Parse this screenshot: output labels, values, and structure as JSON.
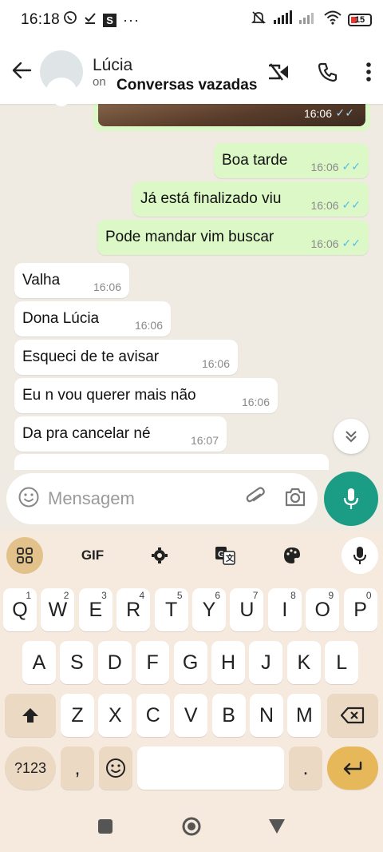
{
  "status_bar": {
    "time": "16:18",
    "battery": "15",
    "left_icons": [
      "whatsapp-icon",
      "check-download-icon",
      "s-app-icon",
      "more-dots-icon"
    ],
    "right_icons": [
      "mute-icon",
      "signal-icon",
      "signal-icon",
      "wifi-icon",
      "battery-icon"
    ]
  },
  "header": {
    "contact_name": "Lúcia",
    "status_partial": "on",
    "overlay_title": "Conversas vazadas"
  },
  "messages": {
    "media": {
      "time": "16:06"
    },
    "outgoing": [
      {
        "text": "Boa tarde",
        "time": "16:06"
      },
      {
        "text": "Já está finalizado viu",
        "time": "16:06"
      },
      {
        "text": "Pode mandar vim buscar",
        "time": "16:06"
      }
    ],
    "incoming": [
      {
        "text": "Valha",
        "time": "16:06"
      },
      {
        "text": "Dona Lúcia",
        "time": "16:06"
      },
      {
        "text": "Esqueci de te avisar",
        "time": "16:06"
      },
      {
        "text": "Eu n vou querer mais não",
        "time": "16:06"
      },
      {
        "text": "Da pra cancelar né",
        "time": "16:07"
      }
    ]
  },
  "composer": {
    "placeholder": "Mensagem"
  },
  "keyboard": {
    "toolbar_gif": "GIF",
    "row1": [
      {
        "k": "Q",
        "n": "1"
      },
      {
        "k": "W",
        "n": "2"
      },
      {
        "k": "E",
        "n": "3"
      },
      {
        "k": "R",
        "n": "4"
      },
      {
        "k": "T",
        "n": "5"
      },
      {
        "k": "Y",
        "n": "6"
      },
      {
        "k": "U",
        "n": "7"
      },
      {
        "k": "I",
        "n": "8"
      },
      {
        "k": "O",
        "n": "9"
      },
      {
        "k": "P",
        "n": "0"
      }
    ],
    "row2": [
      "A",
      "S",
      "D",
      "F",
      "G",
      "H",
      "J",
      "K",
      "L"
    ],
    "row3": [
      "Z",
      "X",
      "C",
      "V",
      "B",
      "N",
      "M"
    ],
    "sym_key": "?123",
    "comma_key": ",",
    "period_key": "."
  }
}
